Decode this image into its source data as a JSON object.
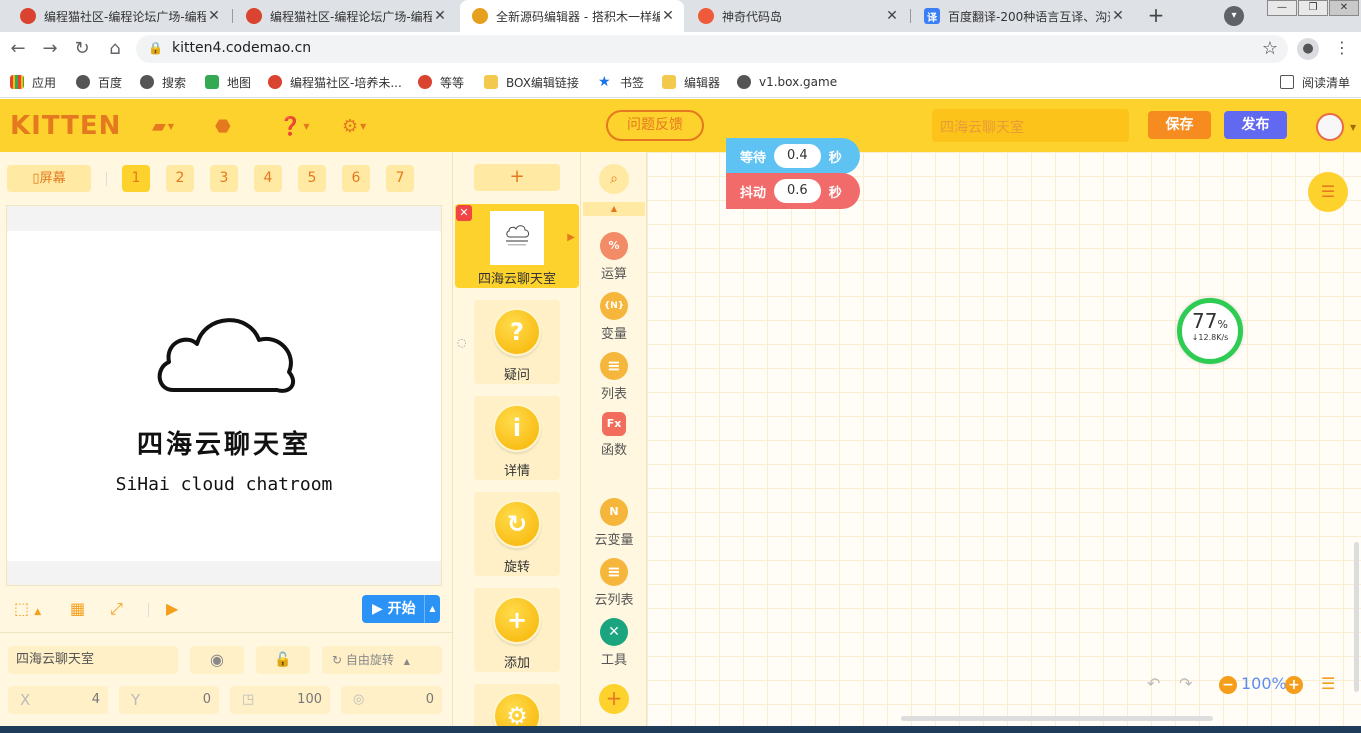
{
  "browser": {
    "tabs": [
      {
        "title": "编程猫社区-编程论坛广场-编程",
        "favicon_color": "#d9432f",
        "active": false
      },
      {
        "title": "编程猫社区-编程论坛广场-编程",
        "favicon_color": "#d9432f",
        "active": false
      },
      {
        "title": "全新源码编辑器 - 搭积木一样编",
        "favicon_color": "#e6a020",
        "active": true
      },
      {
        "title": "神奇代码岛",
        "favicon_color": "#ef5b3a",
        "active": false
      },
      {
        "title": "百度翻译-200种语言互译、沟通",
        "favicon_color": "#3a7ff6",
        "active": false
      }
    ],
    "url": "kitten4.codemao.cn",
    "bookmarks": [
      {
        "label": "应用",
        "icon_color": "#e94235"
      },
      {
        "label": "百度",
        "icon_color": "#555555"
      },
      {
        "label": "搜索",
        "icon_color": "#555555"
      },
      {
        "label": "地图",
        "icon_color": "#34a853"
      },
      {
        "label": "编程猫社区-培养未...",
        "icon_color": "#d9432f"
      },
      {
        "label": "等等",
        "icon_color": "#d9432f"
      },
      {
        "label": "BOX编辑链接",
        "icon_color": "#f2c94c"
      },
      {
        "label": "书签",
        "icon_color": "#1a73e8"
      },
      {
        "label": "编辑器",
        "icon_color": "#f2c94c"
      },
      {
        "label": "v1.box.game",
        "icon_color": "#555555"
      }
    ],
    "reading_list": "阅读清单"
  },
  "app": {
    "logo": "KITTEN",
    "feedback": "问题反馈",
    "project_name": "四海云聊天室",
    "save": "保存",
    "publish": "发布",
    "accent": "#fed22c",
    "accent_dark": "#e4791f"
  },
  "stage": {
    "screen_btn": "屏幕",
    "scenes": [
      "1",
      "2",
      "3",
      "4",
      "5",
      "6",
      "7"
    ],
    "active_scene": "1",
    "title": "四海云聊天室",
    "subtitle": "SiHai cloud chatroom",
    "start": "开始"
  },
  "props": {
    "name": "四海云聊天室",
    "rotate_mode": "自由旋转",
    "x_label": "X",
    "x": "4",
    "y_label": "Y",
    "y": "0",
    "size": "100",
    "direction": "0"
  },
  "actors": {
    "add": "+",
    "selected": "四海云聊天室",
    "list": [
      {
        "name": "疑问",
        "glyph": "?"
      },
      {
        "name": "详情",
        "glyph": "i"
      },
      {
        "name": "旋转",
        "glyph": "↻"
      },
      {
        "name": "添加",
        "glyph": "+"
      }
    ]
  },
  "categories": [
    {
      "label": "运算",
      "glyph": "%",
      "color": "#f28b66"
    },
    {
      "label": "变量",
      "glyph": "{N}",
      "color": "#f5b63b"
    },
    {
      "label": "列表",
      "glyph": "≡",
      "color": "#f5b63b"
    },
    {
      "label": "函数",
      "glyph": "Fx",
      "color": "#f26d5b"
    },
    {
      "label": "云变量",
      "glyph": "N",
      "color": "#f5b63b"
    },
    {
      "label": "云列表",
      "glyph": "≡",
      "color": "#f5b63b"
    },
    {
      "label": "工具",
      "glyph": "✕",
      "color": "#1aa57f"
    }
  ],
  "blocks": [
    {
      "label": "等待",
      "value": "0.4",
      "unit": "秒",
      "color": "#5ec2f2"
    },
    {
      "label": "抖动",
      "value": "0.6",
      "unit": "秒",
      "color": "#f26b6b"
    }
  ],
  "network": {
    "percent": "77",
    "percent_unit": "%",
    "speed": "↓12.8K/s"
  },
  "zoom": "100%"
}
